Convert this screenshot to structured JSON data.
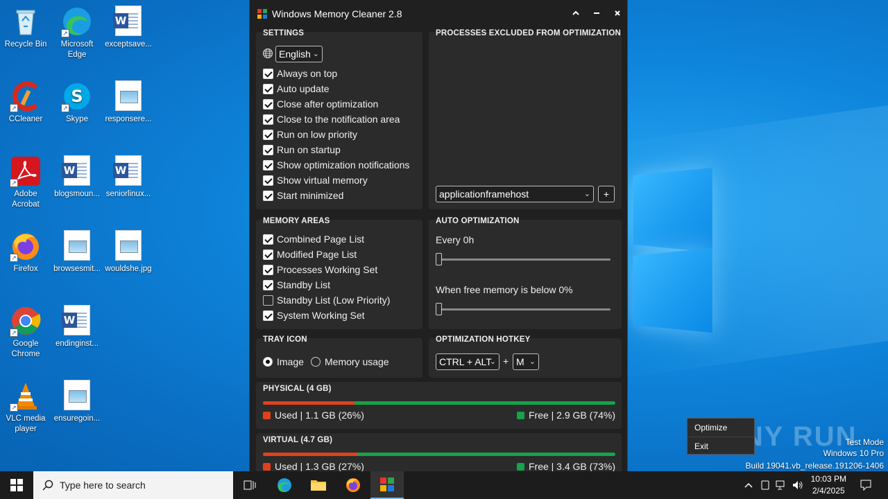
{
  "desktop_icons": [
    {
      "label": "Recycle Bin",
      "icon": "recycle-bin-icon"
    },
    {
      "label": "Microsoft Edge",
      "icon": "edge-icon"
    },
    {
      "label": "exceptsave...",
      "icon": "word-doc-icon"
    },
    {
      "label": "CCleaner",
      "icon": "ccleaner-icon"
    },
    {
      "label": "Skype",
      "icon": "skype-icon"
    },
    {
      "label": "responsere...",
      "icon": "image-file-icon"
    },
    {
      "label": "Adobe Acrobat",
      "icon": "acrobat-icon"
    },
    {
      "label": "blogsmoun...",
      "icon": "word-doc-icon"
    },
    {
      "label": "seniorlinux...",
      "icon": "word-doc-icon"
    },
    {
      "label": "Firefox",
      "icon": "firefox-icon"
    },
    {
      "label": "browsesmit...",
      "icon": "image-file-icon"
    },
    {
      "label": "wouldshe.jpg",
      "icon": "image-file-icon"
    },
    {
      "label": "Google Chrome",
      "icon": "chrome-icon"
    },
    {
      "label": "endinginst...",
      "icon": "word-doc-icon"
    },
    {
      "label": "VLC media player",
      "icon": "vlc-icon"
    },
    {
      "label": "ensuregoin...",
      "icon": "image-file-icon"
    }
  ],
  "app": {
    "title": "Windows Memory Cleaner 2.8",
    "settings": {
      "header": "SETTINGS",
      "language": "English",
      "options": [
        {
          "label": "Always on top",
          "checked": true
        },
        {
          "label": "Auto update",
          "checked": true
        },
        {
          "label": "Close after optimization",
          "checked": true
        },
        {
          "label": "Close to the notification area",
          "checked": true
        },
        {
          "label": "Run on low priority",
          "checked": true
        },
        {
          "label": "Run on startup",
          "checked": true
        },
        {
          "label": "Show optimization notifications",
          "checked": true
        },
        {
          "label": "Show virtual memory",
          "checked": true
        },
        {
          "label": "Start minimized",
          "checked": true
        }
      ]
    },
    "excluded": {
      "header": "PROCESSES EXCLUDED FROM OPTIMIZATION",
      "selected_process": "applicationframehost",
      "add_label": "+"
    },
    "memory_areas": {
      "header": "MEMORY AREAS",
      "options": [
        {
          "label": "Combined Page List",
          "checked": true
        },
        {
          "label": "Modified Page List",
          "checked": true
        },
        {
          "label": "Processes Working Set",
          "checked": true
        },
        {
          "label": "Standby List",
          "checked": true
        },
        {
          "label": "Standby List (Low Priority)",
          "checked": false
        },
        {
          "label": "System Working Set",
          "checked": true
        }
      ]
    },
    "auto_optimization": {
      "header": "AUTO OPTIMIZATION",
      "every_label": "Every 0h",
      "every_value": 0,
      "free_label": "When free memory is below 0%",
      "free_value": 0
    },
    "tray_icon": {
      "header": "TRAY ICON",
      "options": [
        {
          "label": "Image",
          "selected": true
        },
        {
          "label": "Memory usage",
          "selected": false
        }
      ]
    },
    "hotkey": {
      "header": "OPTIMIZATION HOTKEY",
      "modifier": "CTRL + ALT",
      "plus": "+",
      "key": "M"
    },
    "physical": {
      "header": "PHYSICAL (4 GB)",
      "used_label": "Used | 1.1 GB (26%)",
      "free_label": "Free | 2.9 GB (74%)",
      "used_fraction": 0.26
    },
    "virtual": {
      "header": "VIRTUAL (4.7 GB)",
      "used_label": "Used | 1.3 GB (27%)",
      "free_label": "Free | 3.4 GB (73%)",
      "used_fraction": 0.27
    },
    "colors": {
      "used": "#e0411b",
      "free": "#16a34a"
    }
  },
  "context_menu": {
    "items": [
      "Optimize",
      "Exit"
    ]
  },
  "watermark": "ANY RUN",
  "windows_info": {
    "line1": "Test Mode",
    "line2": "Windows 10 Pro",
    "line3": "Build 19041.vb_release.191206-1406"
  },
  "taskbar": {
    "search_placeholder": "Type here to search",
    "time": "10:03 PM",
    "date": "2/4/2025"
  }
}
